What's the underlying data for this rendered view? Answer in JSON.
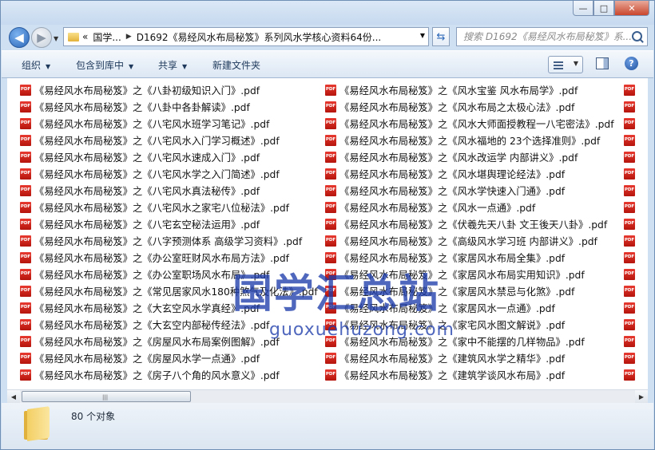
{
  "window": {
    "minimize": "—",
    "maximize": "□",
    "close": "✕"
  },
  "nav": {
    "address_prefix": "«",
    "address_parts": [
      "国学...",
      "D1692《易经风水布局秘笈》系列风水学核心资料64份..."
    ],
    "search_placeholder": "搜索 D1692《易经风水布局秘笈》系..."
  },
  "toolbar": {
    "organize": "组织",
    "include": "包含到库中",
    "share": "共享",
    "new_folder": "新建文件夹",
    "help": "?"
  },
  "files_col1": [
    "《易经风水布局秘笈》之《八卦初级知识入门》.pdf",
    "《易经风水布局秘笈》之《八卦中各卦解读》.pdf",
    "《易经风水布局秘笈》之《八宅风水班学习笔记》.pdf",
    "《易经风水布局秘笈》之《八宅风水入门学习概述》.pdf",
    "《易经风水布局秘笈》之《八宅风水速成入门》.pdf",
    "《易经风水布局秘笈》之《八宅风水学之入门简述》.pdf",
    "《易经风水布局秘笈》之《八宅风水真法秘传》.pdf",
    "《易经风水布局秘笈》之《八宅风水之家宅八位秘法》.pdf",
    "《易经风水布局秘笈》之《八宅玄空秘法运用》.pdf",
    "《易经风水布局秘笈》之《八字预测体系 高级学习资料》.pdf",
    "《易经风水布局秘笈》之《办公室旺财风水布局方法》.pdf",
    "《易经风水布局秘笈》之《办公室职场风水布局》.pdf",
    "《易经风水布局秘笈》之《常见居家风水180种煞气及化法》.pdf",
    "《易经风水布局秘笈》之《大玄空风水学真经》.pdf",
    "《易经风水布局秘笈》之《大玄空内部秘传经法》.pdf",
    "《易经风水布局秘笈》之《房屋风水布局案例图解》.pdf",
    "《易经风水布局秘笈》之《房屋风水学一点通》.pdf",
    "《易经风水布局秘笈》之《房子八个角的风水意义》.pdf"
  ],
  "files_col2": [
    "《易经风水布局秘笈》之《风水宝鉴 风水布局学》.pdf",
    "《易经风水布局秘笈》之《风水布局之太极心法》.pdf",
    "《易经风水布局秘笈》之《风水大师面授教程一八宅密法》.pdf",
    "《易经风水布局秘笈》之《风水福地的 23个选择准则》.pdf",
    "《易经风水布局秘笈》之《风水改运学 内部讲义》.pdf",
    "《易经风水布局秘笈》之《风水堪舆理论经法》.pdf",
    "《易经风水布局秘笈》之《风水学快速入门通》.pdf",
    "《易经风水布局秘笈》之《风水一点通》.pdf",
    "《易经风水布局秘笈》之《伏羲先天八卦 文王後天八卦》.pdf",
    "《易经风水布局秘笈》之《高级风水学习班 内部讲义》.pdf",
    "《易经风水布局秘笈》之《家居风水布局全集》.pdf",
    "《易经风水布局秘笈》之《家居风水布局实用知识》.pdf",
    "《易经风水布局秘笈》之《家居风水禁忌与化煞》.pdf",
    "《易经风水布局秘笈》之《家居风水一点通》.pdf",
    "《易经风水布局秘笈》之《家宅风水图文解说》.pdf",
    "《易经风水布局秘笈》之《家中不能摆的几样物品》.pdf",
    "《易经风水布局秘笈》之《建筑风水学之精华》.pdf",
    "《易经风水布局秘笈》之《建筑学谈风水布局》.pdf"
  ],
  "watermark": {
    "cn": "国学汇总站",
    "en": "guoxuehuzong.com"
  },
  "scrollbar": {
    "left": "◀",
    "right": "▶",
    "grip": "|||"
  },
  "status": {
    "count": "80 个对象"
  }
}
